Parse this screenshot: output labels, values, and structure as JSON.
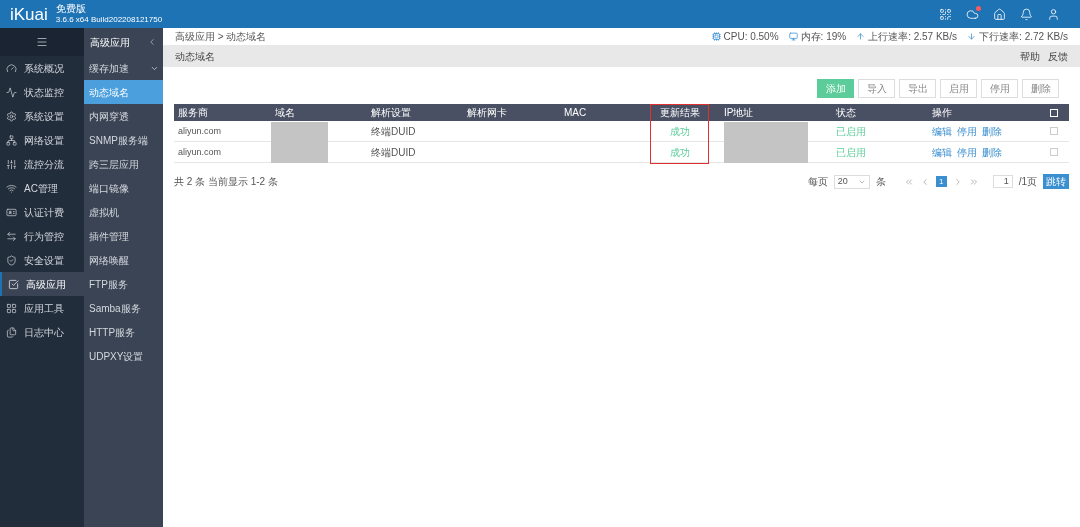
{
  "header": {
    "logo": "iKuai",
    "edition": "免费版",
    "version": "3.6.6 x64 Build202208121750",
    "cloud_alert": true
  },
  "nav": [
    {
      "label": "系统概况",
      "selected": false
    },
    {
      "label": "状态监控",
      "selected": false
    },
    {
      "label": "系统设置",
      "selected": false
    },
    {
      "label": "网络设置",
      "selected": false
    },
    {
      "label": "流控分流",
      "selected": false
    },
    {
      "label": "AC管理",
      "selected": false
    },
    {
      "label": "认证计费",
      "selected": false
    },
    {
      "label": "行为管控",
      "selected": false
    },
    {
      "label": "安全设置",
      "selected": false
    },
    {
      "label": "高级应用",
      "selected": true
    },
    {
      "label": "应用工具",
      "selected": false
    },
    {
      "label": "日志中心",
      "selected": false
    }
  ],
  "subnav": {
    "title": "高级应用",
    "items": [
      {
        "label": "缓存加速",
        "expanded": false,
        "selected": false
      },
      {
        "label": "动态域名",
        "selected": true
      },
      {
        "label": "内网穿透",
        "selected": false
      },
      {
        "label": "SNMP服务端",
        "selected": false
      },
      {
        "label": "跨三层应用",
        "selected": false
      },
      {
        "label": "端口镜像",
        "selected": false
      },
      {
        "label": "虚拟机",
        "selected": false
      },
      {
        "label": "插件管理",
        "selected": false
      },
      {
        "label": "网络唤醒",
        "selected": false
      },
      {
        "label": "FTP服务",
        "selected": false
      },
      {
        "label": "Samba服务",
        "selected": false
      },
      {
        "label": "HTTP服务",
        "selected": false
      },
      {
        "label": "UDPXY设置",
        "selected": false
      }
    ]
  },
  "breadcrumb": "高级应用 > 动态域名",
  "stats": [
    {
      "kind": "cpu",
      "text": "CPU: 0.50%"
    },
    {
      "kind": "mem",
      "text": "内存: 19%"
    },
    {
      "kind": "up",
      "text": "上行速率: 2.57 KB/s"
    },
    {
      "kind": "down",
      "text": "下行速率: 2.72 KB/s"
    }
  ],
  "page_title": "动态域名",
  "help_links": [
    "帮助",
    "反馈"
  ],
  "toolbar": [
    {
      "label": "添加",
      "kind": "primary"
    },
    {
      "label": "导入",
      "kind": "plain"
    },
    {
      "label": "导出",
      "kind": "plain"
    },
    {
      "label": "启用",
      "kind": "plain"
    },
    {
      "label": "停用",
      "kind": "plain"
    },
    {
      "label": "删除",
      "kind": "plain"
    }
  ],
  "table": {
    "columns": [
      {
        "label": "服务商",
        "highlighted": false
      },
      {
        "label": "域名",
        "highlighted": false
      },
      {
        "label": "解析设置",
        "highlighted": false
      },
      {
        "label": "解析网卡",
        "highlighted": false
      },
      {
        "label": "MAC",
        "highlighted": false
      },
      {
        "label": "更新结果",
        "highlighted": true
      },
      {
        "label": "IP地址",
        "highlighted": false
      },
      {
        "label": "状态",
        "highlighted": false
      },
      {
        "label": "操作",
        "highlighted": false
      }
    ],
    "rows": [
      {
        "provider": "aliyun.com",
        "setting": "终端DUID",
        "result": "成功",
        "status": "已启用",
        "actions": [
          "编辑",
          "停用",
          "删除"
        ],
        "checked": false
      },
      {
        "provider": "aliyun.com",
        "setting": "终端DUID",
        "result": "成功",
        "status": "已启用",
        "actions": [
          "编辑",
          "停用",
          "删除"
        ],
        "checked": false
      }
    ],
    "all_checked": false
  },
  "footer": {
    "summary": "共 2 条 当前显示 1-2 条",
    "per_page_label": "每页",
    "per_page": "20",
    "unit": "条",
    "page": "1",
    "page_input": "1",
    "total_pages": "/1页",
    "go": "跳转"
  }
}
